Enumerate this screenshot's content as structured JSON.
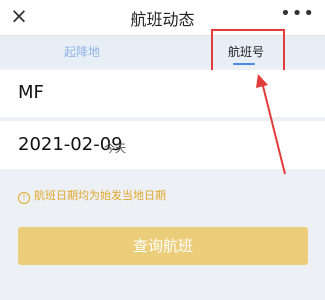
{
  "header": {
    "close_icon": "×",
    "title": "航班动态",
    "more_icon": "•••"
  },
  "tabs": [
    {
      "label": "起降地",
      "active": false
    },
    {
      "label": "航班号",
      "active": true
    }
  ],
  "form": {
    "flight_no": "MF",
    "date": "2021-02-09",
    "date_note": "今天"
  },
  "notice": {
    "icon": "!",
    "text": "航班日期均为始发当地日期"
  },
  "button": {
    "label": "查询航班"
  },
  "colors": {
    "accent": "#4d89e6",
    "notice": "#e0a82a",
    "button": "#eccd7a",
    "annotation": "#e23b3b"
  }
}
